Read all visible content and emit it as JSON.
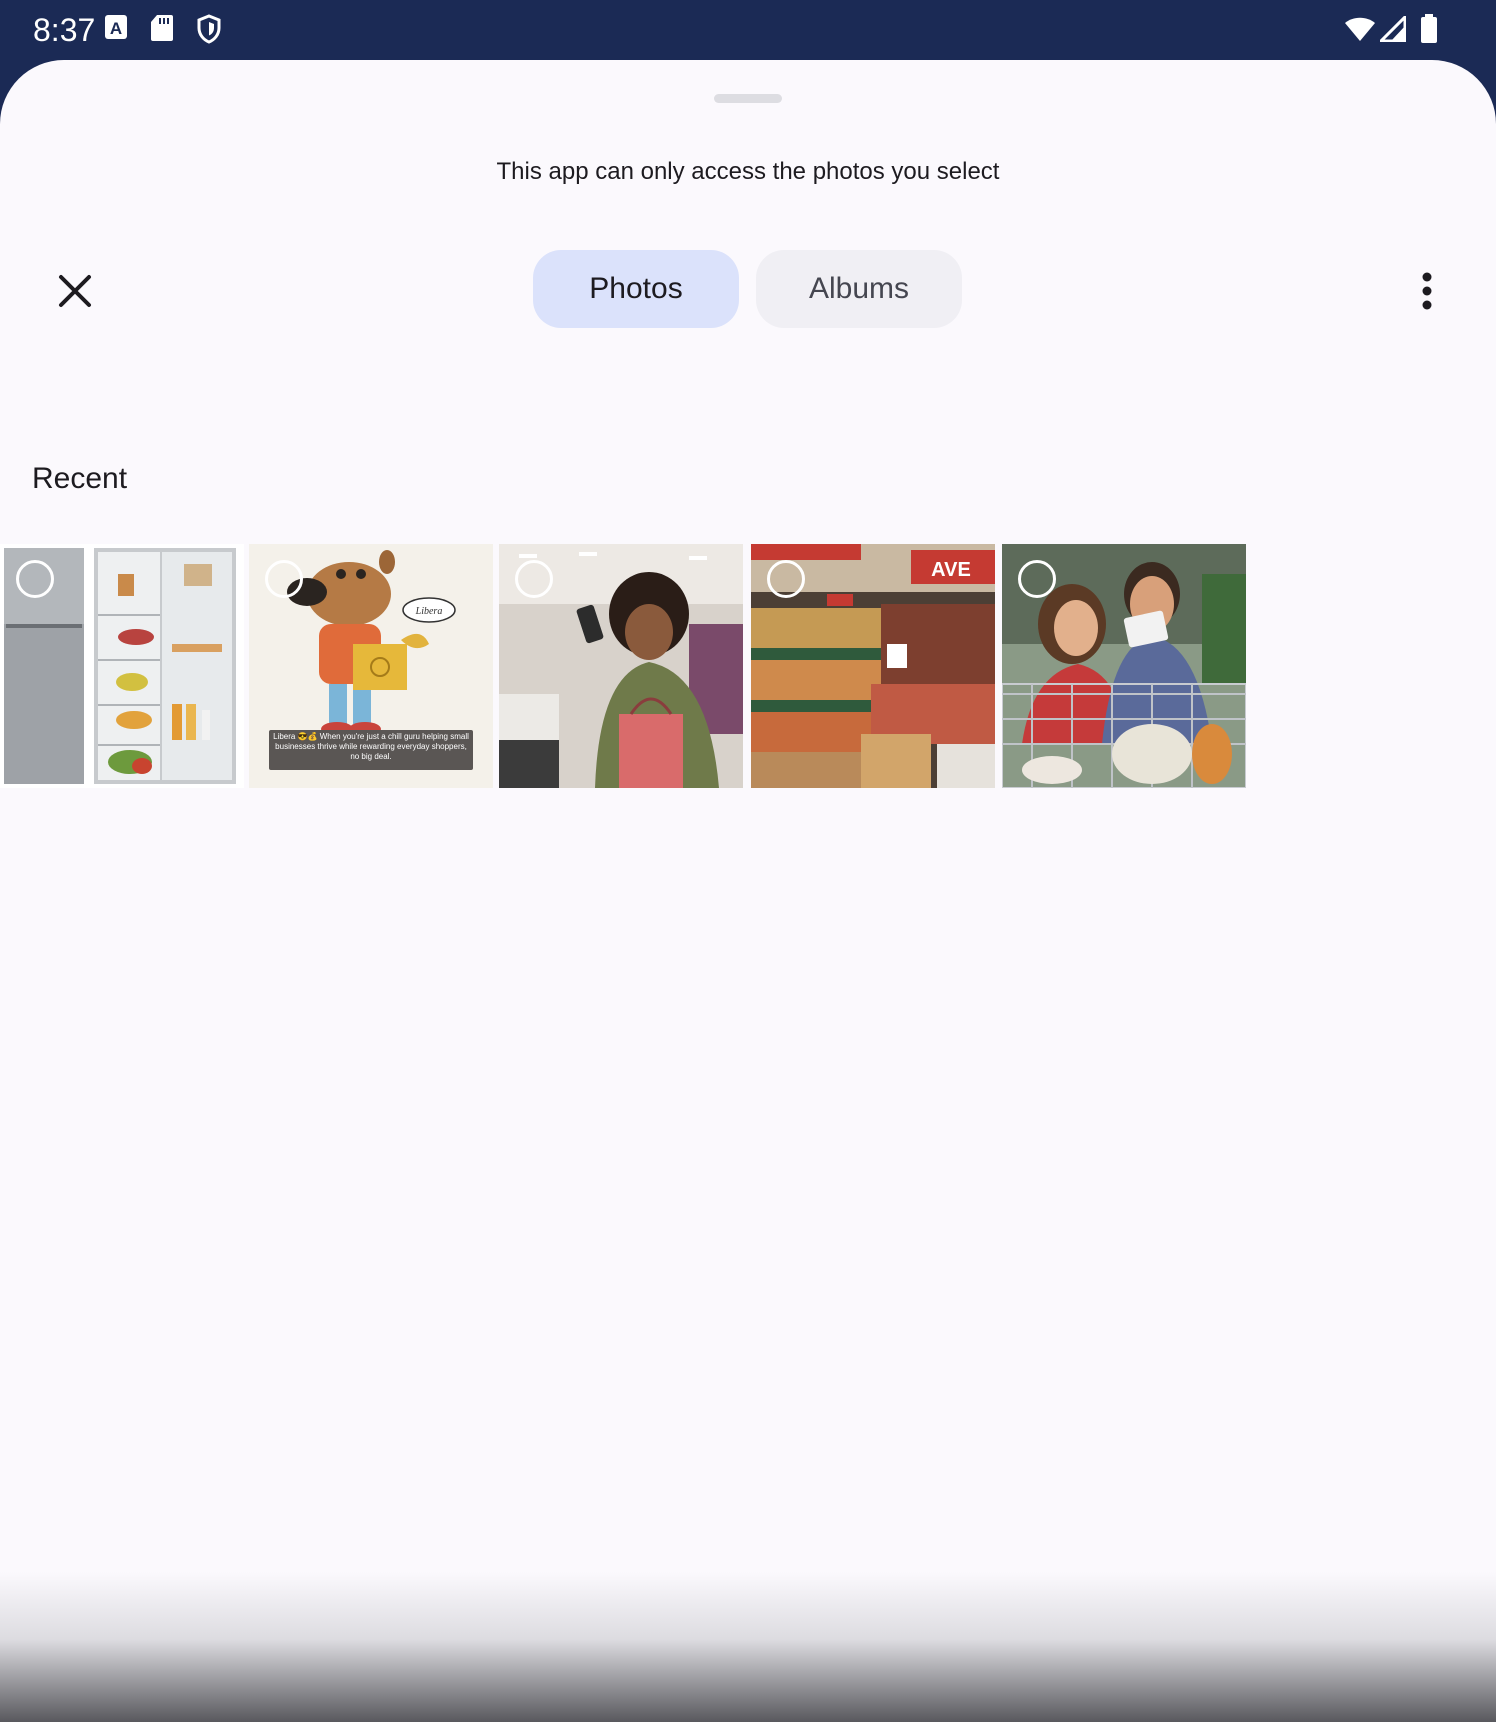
{
  "status_bar": {
    "time": "8:37",
    "left_icons": [
      "a-notification-icon",
      "sd-card-icon",
      "shield-icon"
    ],
    "right_icons": [
      "wifi-icon",
      "cell-signal-icon",
      "battery-icon"
    ]
  },
  "sheet": {
    "subtitle": "This app can only access the photos you select",
    "tabs": [
      {
        "label": "Photos",
        "selected": true
      },
      {
        "label": "Albums",
        "selected": false
      }
    ],
    "section_title": "Recent",
    "caption_card_text": "Libera 😎💰 When you're just a chill guru helping small businesses thrive while rewarding everyday shoppers, no big deal.",
    "bubble_text": "Libera",
    "colors": {
      "status_bar_bg": "#1b2a55",
      "sheet_bg": "#fbf9fd",
      "selected_tab_bg": "#dbe2fb",
      "unselected_tab_bg": "#f0eff4"
    }
  }
}
